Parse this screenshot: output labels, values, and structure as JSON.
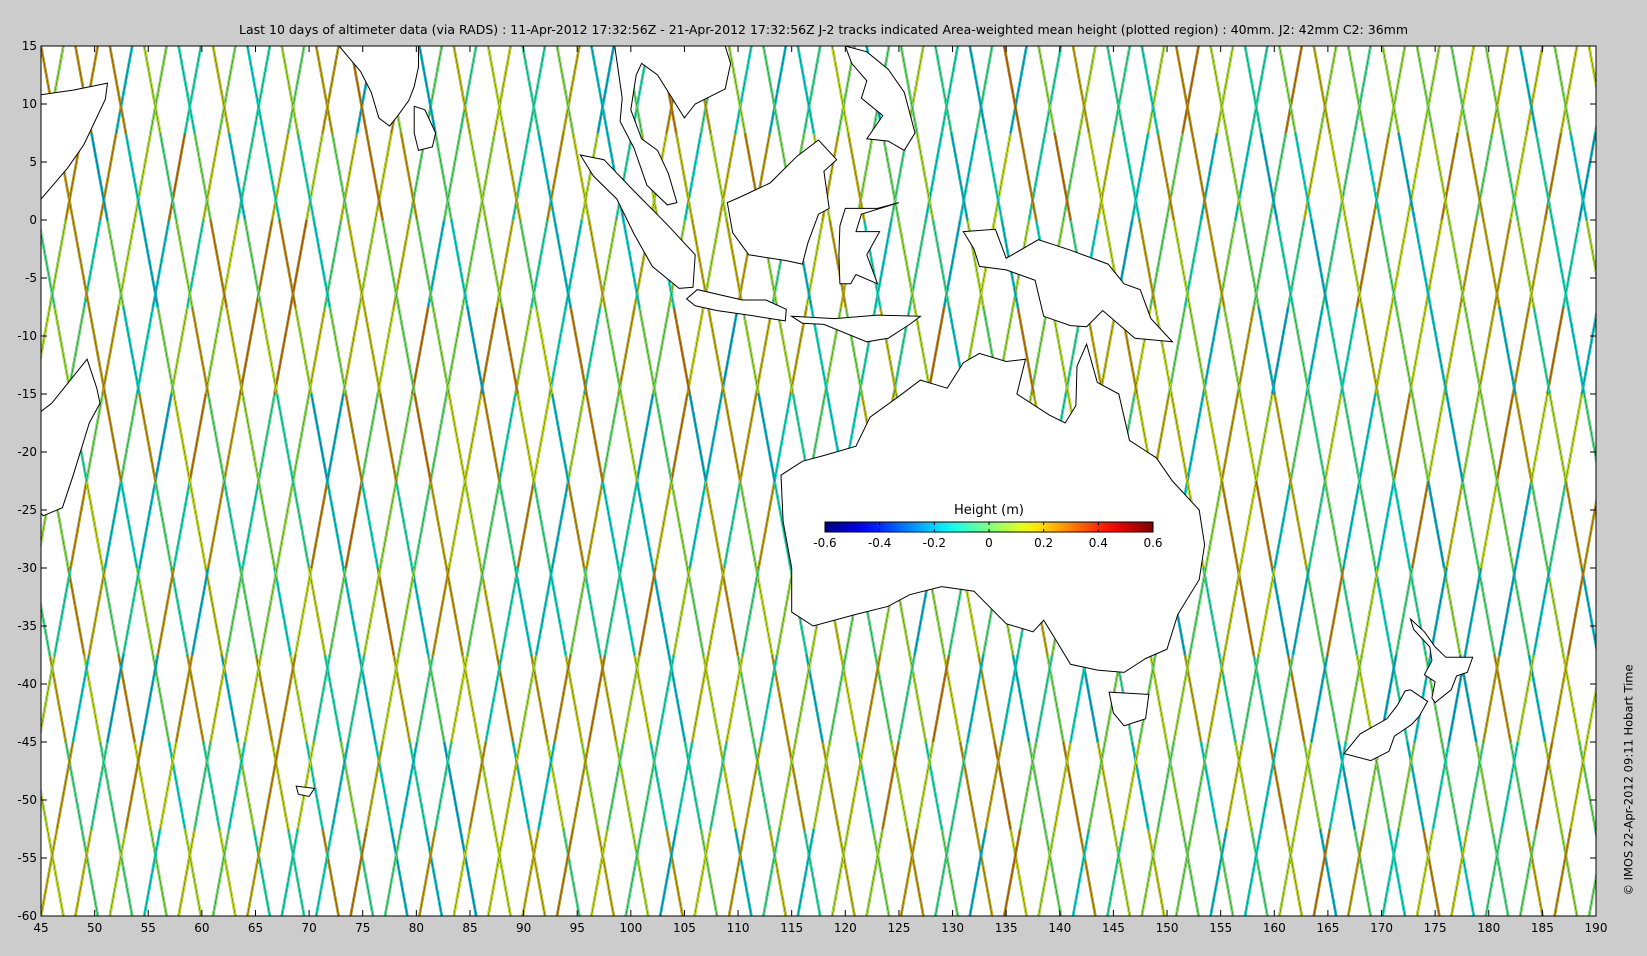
{
  "title": "Last 10 days of altimeter data (via RADS) : 11-Apr-2012 17:32:56Z - 21-Apr-2012 17:32:56Z  J-2 tracks indicated  Area-weighted mean height (plotted region) : 40mm.  J2: 42mm  C2: 36mm",
  "credit": "© IMOS 22-Apr-2012 09:11 Hobart Time",
  "map": {
    "lon_range": [
      45,
      190
    ],
    "lat_range": [
      -60,
      15
    ],
    "x_ticks": [
      45,
      50,
      55,
      60,
      65,
      70,
      75,
      80,
      85,
      90,
      95,
      100,
      105,
      110,
      115,
      120,
      125,
      130,
      135,
      140,
      145,
      150,
      155,
      160,
      165,
      170,
      175,
      180,
      185,
      190
    ],
    "y_ticks": [
      15,
      10,
      5,
      0,
      -5,
      -10,
      -15,
      -20,
      -25,
      -30,
      -35,
      -40,
      -45,
      -50,
      -55,
      -60
    ],
    "x_tick_labels": [
      "45",
      "50",
      "55",
      "60",
      "65",
      "70",
      "75",
      "80",
      "85",
      "90",
      "95",
      "100",
      "105",
      "110",
      "115",
      "120",
      "125",
      "130",
      "135",
      "140",
      "145",
      "150",
      "155",
      "160",
      "165",
      "170",
      "175",
      "180",
      "185",
      "190"
    ],
    "y_tick_labels": [
      "15",
      "10",
      "5",
      "0",
      "-5",
      "-10",
      "-15",
      "-20",
      "-25",
      "-30",
      "-35",
      "-40",
      "-45",
      "-50",
      "-55",
      "-60"
    ],
    "land_color": "#ffffff",
    "ocean_color": "#ffffff",
    "coast_color": "#000000"
  },
  "colorbar": {
    "label": "Height (m)",
    "range": [
      -0.6,
      0.6
    ],
    "ticks": [
      -0.6,
      -0.4,
      -0.2,
      0,
      0.2,
      0.4,
      0.6
    ],
    "tick_labels": [
      "-0.6",
      "-0.4",
      "-0.2",
      "0",
      "0.2",
      "0.4",
      "0.6"
    ],
    "colormap": "jet",
    "colors": [
      "#00008f",
      "#0000ff",
      "#00a0ff",
      "#00ffff",
      "#4bd44b",
      "#ffff00",
      "#ff8000",
      "#ff0000",
      "#800000"
    ]
  }
}
